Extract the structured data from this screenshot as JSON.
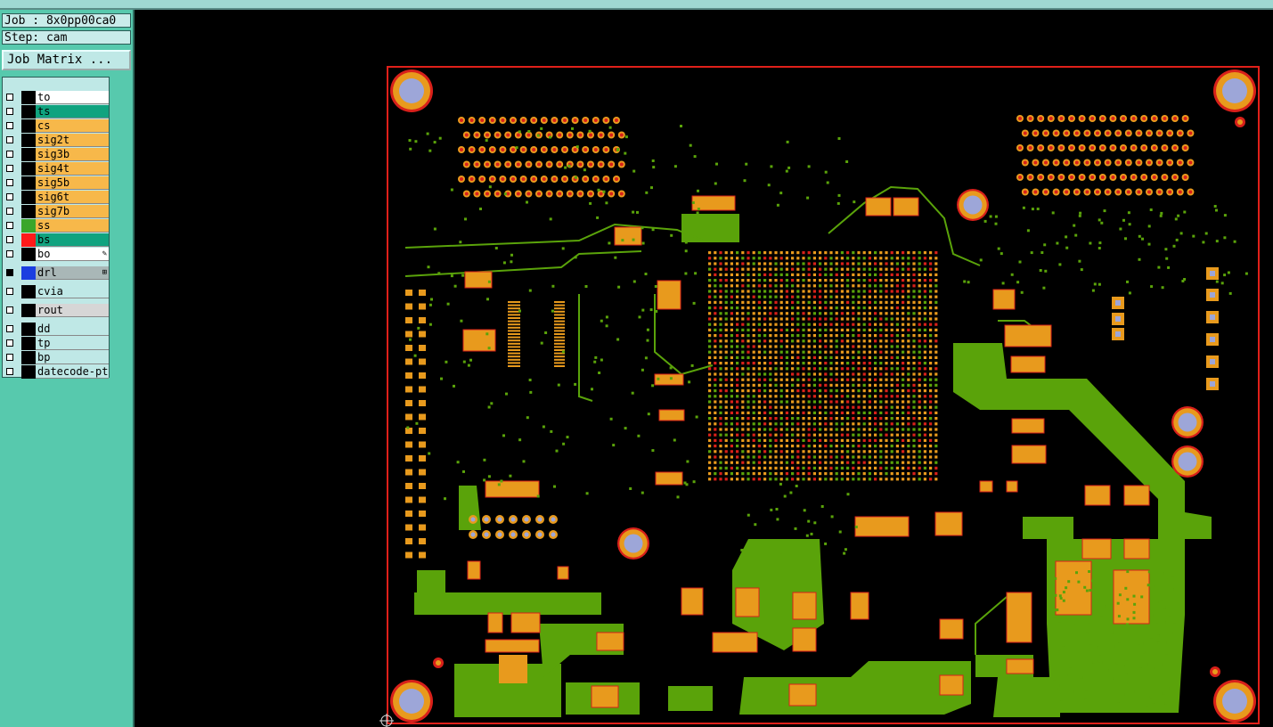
{
  "job": {
    "label": "Job : 8x0pp00ca0",
    "step": "Step: cam"
  },
  "job_matrix_button": "Job Matrix ...",
  "layers": [
    {
      "name": "to",
      "bg": "#ffffff",
      "swatch": "#000000"
    },
    {
      "name": "ts",
      "bg": "#10a37f",
      "swatch": "#000000"
    },
    {
      "name": "cs",
      "bg": "#f7b84a",
      "swatch": "#000000"
    },
    {
      "name": "sig2t",
      "bg": "#f7b84a",
      "swatch": "#000000"
    },
    {
      "name": "sig3b",
      "bg": "#f7b84a",
      "swatch": "#000000"
    },
    {
      "name": "sig4t",
      "bg": "#f7b84a",
      "swatch": "#000000"
    },
    {
      "name": "sig5b",
      "bg": "#f7b84a",
      "swatch": "#000000"
    },
    {
      "name": "sig6t",
      "bg": "#f7b84a",
      "swatch": "#000000"
    },
    {
      "name": "sig7b",
      "bg": "#f7b84a",
      "swatch": "#000000"
    },
    {
      "name": "ss",
      "bg": "#f7b84a",
      "swatch": "#3aa62a"
    },
    {
      "name": "bs",
      "bg": "#10a37f",
      "swatch": "#ff1a1a"
    },
    {
      "name": "bo",
      "bg": "#ffffff",
      "swatch": "#000000",
      "marker": "✎"
    },
    {
      "name": "drl",
      "bg": "#a9b7b7",
      "swatch": "#1b3ee0",
      "marker": "⊞",
      "checked": true
    },
    {
      "name": "cvia",
      "bg": "#bfe8e6",
      "swatch": "#000000"
    },
    {
      "name": "rout",
      "bg": "#d6d6d6",
      "swatch": "#000000"
    },
    {
      "name": "dd",
      "bg": "#bfe8e6",
      "swatch": "#000000"
    },
    {
      "name": "tp",
      "bg": "#bfe8e6",
      "swatch": "#000000"
    },
    {
      "name": "bp",
      "bg": "#bfe8e6",
      "swatch": "#000000"
    },
    {
      "name": "datecode-pt",
      "bg": "#bfe8e6",
      "swatch": "#000000"
    }
  ],
  "colors": {
    "copper": "#5aa30a",
    "pad": "#e89a1d",
    "mask": "#d8201a",
    "drill": "#9da6d8",
    "outline": "#e0201a"
  },
  "icons": {
    "origin": "crosshair-icon",
    "edit": "pencil-icon"
  }
}
